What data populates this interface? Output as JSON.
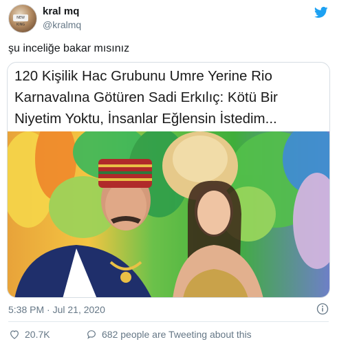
{
  "author": {
    "name": "kral mq",
    "handle": "@kralmq",
    "avatar_badge": "NEW KING"
  },
  "tweet": {
    "text": "şu inceliğe bakar mısınız"
  },
  "card": {
    "headline": "120 Kişilik Hac Grubunu Umre Yerine Rio Karnavalına Götüren Sadi Erkılıç: Kötü Bir Niyetim Yoktu, İnsanlar Eğlensin İstedim..."
  },
  "meta": {
    "timestamp": "5:38 PM · Jul 21, 2020"
  },
  "actions": {
    "like_count": "20.7K",
    "reply_text": "682 people are Tweeting about this"
  },
  "colors": {
    "twitter_blue": "#1da1f2",
    "secondary_text": "#657786",
    "divider": "#e1e8ed"
  },
  "icons": {
    "brand": "twitter-bird-icon",
    "info": "info-icon",
    "like": "heart-icon",
    "reply": "speech-bubble-icon"
  }
}
